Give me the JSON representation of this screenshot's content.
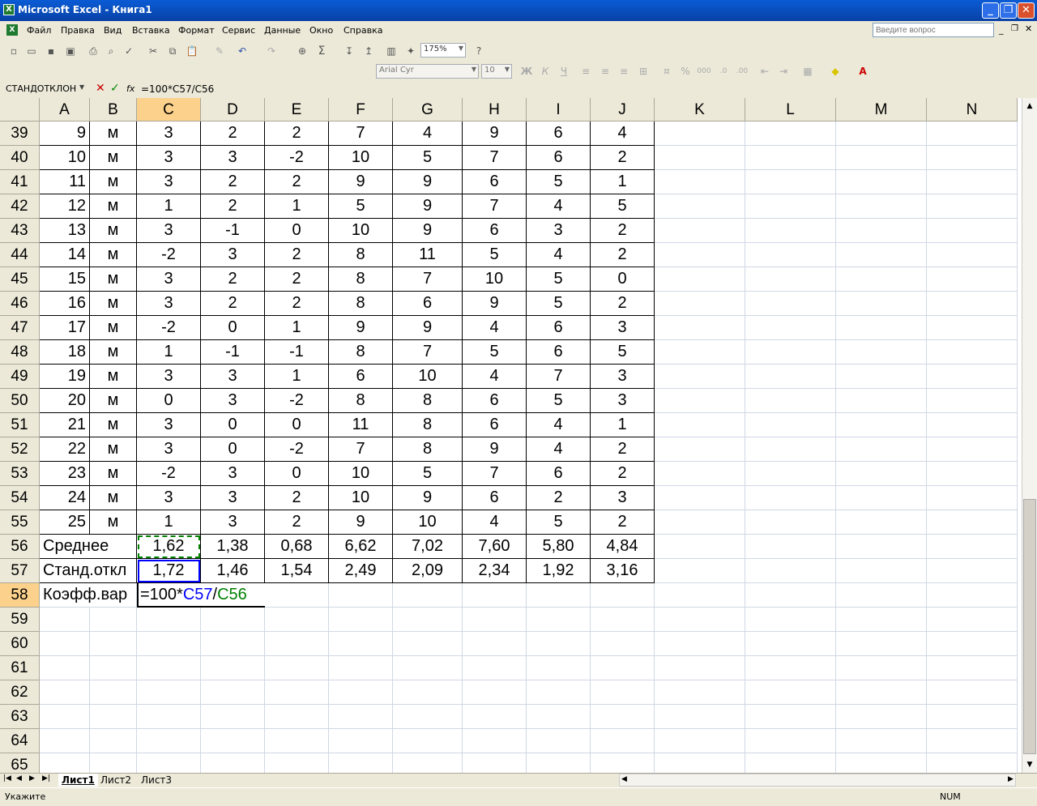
{
  "window": {
    "title": "Microsoft Excel - Книга1",
    "app_icon": "excel-icon"
  },
  "menu": [
    {
      "label": "Файл"
    },
    {
      "label": "Правка"
    },
    {
      "label": "Вид"
    },
    {
      "label": "Вставка"
    },
    {
      "label": "Формат"
    },
    {
      "label": "Сервис"
    },
    {
      "label": "Данные"
    },
    {
      "label": "Окно"
    },
    {
      "label": "Справка"
    }
  ],
  "help_box": {
    "placeholder": "Введите вопрос"
  },
  "toolbar": {
    "zoom": "175%",
    "font_name": "Arial Cyr",
    "font_size": "10"
  },
  "formula_bar": {
    "name_box": "СТАНДОТКЛОН",
    "fx": "fx",
    "formula": "=100*C57/C56"
  },
  "columns": [
    "A",
    "B",
    "C",
    "D",
    "E",
    "F",
    "G",
    "H",
    "I",
    "J",
    "K",
    "L",
    "M",
    "N"
  ],
  "rows": [
    {
      "n": "39",
      "cells": [
        "9",
        "м",
        "3",
        "2",
        "2",
        "7",
        "4",
        "9",
        "6",
        "4"
      ]
    },
    {
      "n": "40",
      "cells": [
        "10",
        "м",
        "3",
        "3",
        "-2",
        "10",
        "5",
        "7",
        "6",
        "2"
      ]
    },
    {
      "n": "41",
      "cells": [
        "11",
        "м",
        "3",
        "2",
        "2",
        "9",
        "9",
        "6",
        "5",
        "1"
      ]
    },
    {
      "n": "42",
      "cells": [
        "12",
        "м",
        "1",
        "2",
        "1",
        "5",
        "9",
        "7",
        "4",
        "5"
      ]
    },
    {
      "n": "43",
      "cells": [
        "13",
        "м",
        "3",
        "-1",
        "0",
        "10",
        "9",
        "6",
        "3",
        "2"
      ]
    },
    {
      "n": "44",
      "cells": [
        "14",
        "м",
        "-2",
        "3",
        "2",
        "8",
        "11",
        "5",
        "4",
        "2"
      ]
    },
    {
      "n": "45",
      "cells": [
        "15",
        "м",
        "3",
        "2",
        "2",
        "8",
        "7",
        "10",
        "5",
        "0"
      ]
    },
    {
      "n": "46",
      "cells": [
        "16",
        "м",
        "3",
        "2",
        "2",
        "8",
        "6",
        "9",
        "5",
        "2"
      ]
    },
    {
      "n": "47",
      "cells": [
        "17",
        "м",
        "-2",
        "0",
        "1",
        "9",
        "9",
        "4",
        "6",
        "3"
      ]
    },
    {
      "n": "48",
      "cells": [
        "18",
        "м",
        "1",
        "-1",
        "-1",
        "8",
        "7",
        "5",
        "6",
        "5"
      ]
    },
    {
      "n": "49",
      "cells": [
        "19",
        "м",
        "3",
        "3",
        "1",
        "6",
        "10",
        "4",
        "7",
        "3"
      ]
    },
    {
      "n": "50",
      "cells": [
        "20",
        "м",
        "0",
        "3",
        "-2",
        "8",
        "8",
        "6",
        "5",
        "3"
      ]
    },
    {
      "n": "51",
      "cells": [
        "21",
        "м",
        "3",
        "0",
        "0",
        "11",
        "8",
        "6",
        "4",
        "1"
      ]
    },
    {
      "n": "52",
      "cells": [
        "22",
        "м",
        "3",
        "0",
        "-2",
        "7",
        "8",
        "9",
        "4",
        "2"
      ]
    },
    {
      "n": "53",
      "cells": [
        "23",
        "м",
        "-2",
        "3",
        "0",
        "10",
        "5",
        "7",
        "6",
        "2"
      ]
    },
    {
      "n": "54",
      "cells": [
        "24",
        "м",
        "3",
        "3",
        "2",
        "10",
        "9",
        "6",
        "2",
        "3"
      ]
    },
    {
      "n": "55",
      "cells": [
        "25",
        "м",
        "1",
        "3",
        "2",
        "9",
        "10",
        "4",
        "5",
        "2"
      ]
    }
  ],
  "summary": {
    "mean": {
      "n": "56",
      "label": "Среднее",
      "values": [
        "1,62",
        "1,38",
        "0,68",
        "6,62",
        "7,02",
        "7,60",
        "5,80",
        "4,84"
      ]
    },
    "std": {
      "n": "57",
      "label": "Станд.откл",
      "values": [
        "1,72",
        "1,46",
        "1,54",
        "2,49",
        "2,09",
        "2,34",
        "1,92",
        "3,16"
      ]
    },
    "coef": {
      "n": "58",
      "label": "Коэфф.вар",
      "formula_prefix": "=100*",
      "ref1": "C57",
      "slash": "/",
      "ref2": "C56"
    }
  },
  "empty_rows": [
    "59",
    "60",
    "61",
    "62",
    "63",
    "64",
    "65"
  ],
  "sheets": [
    "Лист1",
    "Лист2",
    "Лист3"
  ],
  "status": {
    "left": "Укажите",
    "num": "NUM"
  },
  "colors": {
    "ref1": "#0000ff",
    "ref2": "#008000",
    "selection": "#fbd18b"
  }
}
